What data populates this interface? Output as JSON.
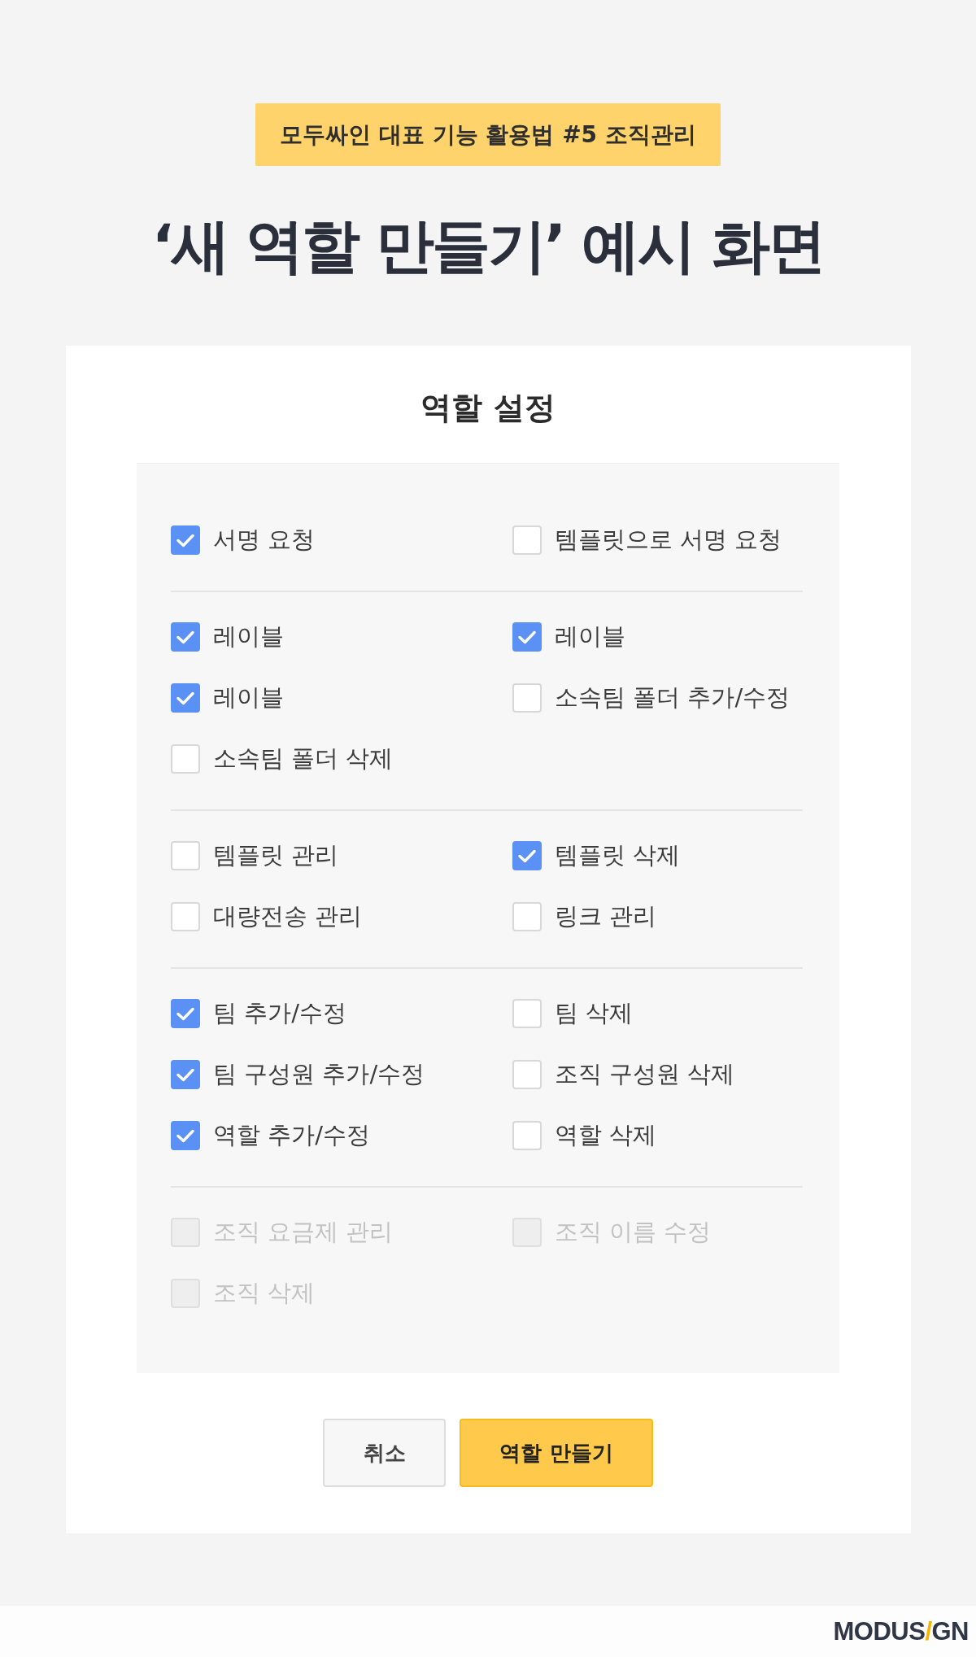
{
  "header": {
    "tag": "모두싸인 대표 기능 활용법 #5 조직관리",
    "headline": "‘새 역할 만들기’ 예시 화면"
  },
  "dialog": {
    "title": "역할 설정",
    "groups": [
      {
        "items": [
          {
            "label": "서명 요청",
            "checked": true,
            "disabled": false
          },
          {
            "label": "템플릿으로 서명 요청",
            "checked": false,
            "disabled": false
          }
        ]
      },
      {
        "items": [
          {
            "label": "레이블",
            "checked": true,
            "disabled": false
          },
          {
            "label": "레이블",
            "checked": true,
            "disabled": false
          },
          {
            "label": "레이블",
            "checked": true,
            "disabled": false
          },
          {
            "label": "소속팀 폴더 추가/수정",
            "checked": false,
            "disabled": false
          },
          {
            "label": "소속팀 폴더 삭제",
            "checked": false,
            "disabled": false
          }
        ]
      },
      {
        "items": [
          {
            "label": "템플릿 관리",
            "checked": false,
            "disabled": false
          },
          {
            "label": "템플릿 삭제",
            "checked": true,
            "disabled": false
          },
          {
            "label": "대량전송 관리",
            "checked": false,
            "disabled": false
          },
          {
            "label": "링크 관리",
            "checked": false,
            "disabled": false
          }
        ]
      },
      {
        "items": [
          {
            "label": "팀 추가/수정",
            "checked": true,
            "disabled": false
          },
          {
            "label": "팀 삭제",
            "checked": false,
            "disabled": false
          },
          {
            "label": "팀 구성원 추가/수정",
            "checked": true,
            "disabled": false
          },
          {
            "label": "조직 구성원 삭제",
            "checked": false,
            "disabled": false
          },
          {
            "label": "역할 추가/수정",
            "checked": true,
            "disabled": false
          },
          {
            "label": "역할 삭제",
            "checked": false,
            "disabled": false
          }
        ]
      },
      {
        "items": [
          {
            "label": "조직 요금제 관리",
            "checked": false,
            "disabled": true
          },
          {
            "label": "조직 이름 수정",
            "checked": false,
            "disabled": true
          },
          {
            "label": "조직 삭제",
            "checked": false,
            "disabled": true
          }
        ]
      }
    ],
    "buttons": [
      {
        "label": "취소",
        "kind": "secondary"
      },
      {
        "label": "역할 만들기",
        "kind": "primary"
      }
    ]
  },
  "footer": {
    "logo": [
      {
        "text": "MODUS",
        "accent": false
      },
      {
        "text": "/",
        "accent": true
      },
      {
        "text": "GN",
        "accent": false
      }
    ]
  }
}
